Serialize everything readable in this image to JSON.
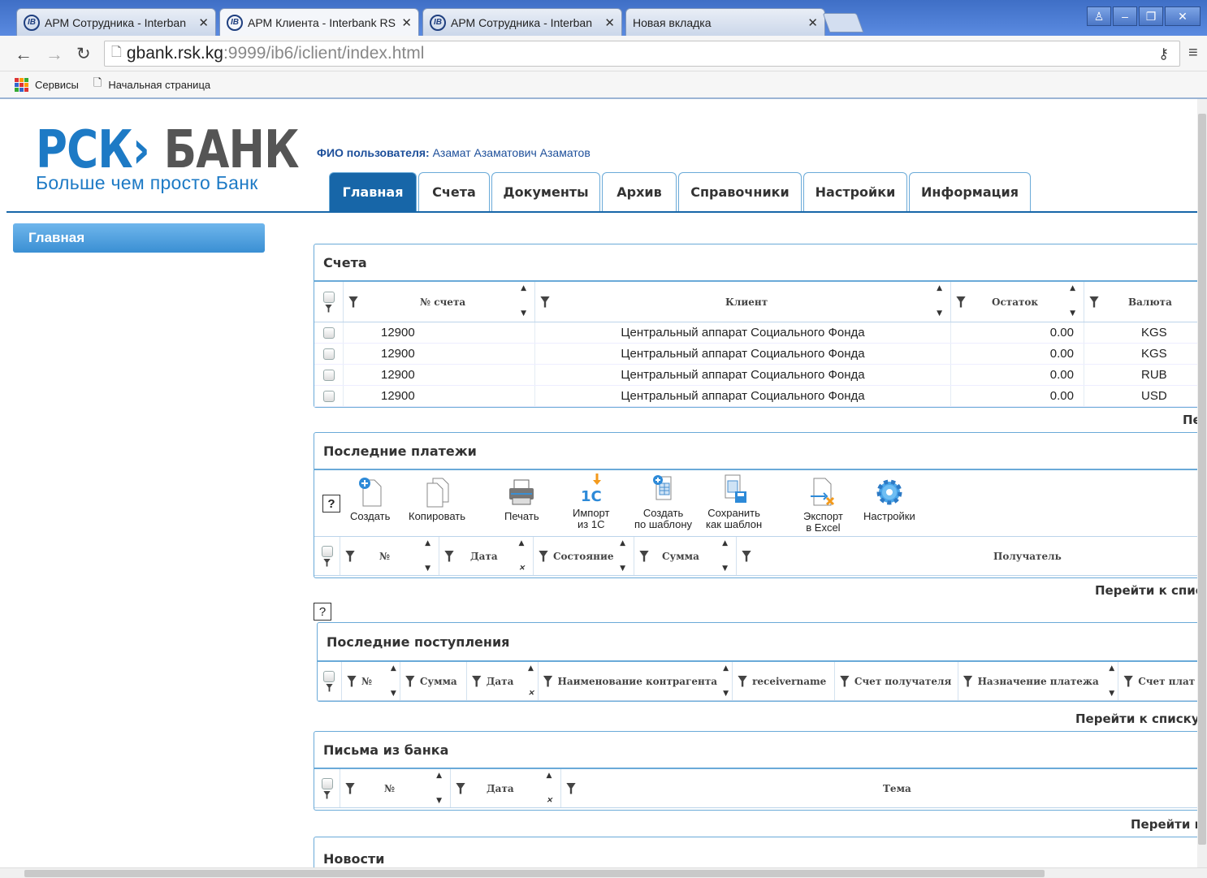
{
  "browser": {
    "tabs": [
      {
        "label": "АРМ Сотрудника - Interban"
      },
      {
        "label": "АРМ Клиента - Interbank RS"
      },
      {
        "label": "АРМ Сотрудника - Interban"
      },
      {
        "label": "Новая вкладка"
      }
    ],
    "url_host": "gbank.rsk.kg",
    "url_rest": ":9999/ib6/iclient/index.html",
    "bookmarks": [
      "Сервисы",
      "Начальная страница"
    ]
  },
  "logo": {
    "rsk": "РСК›",
    "bank": "БАНК",
    "slogan": "Больше чем просто Банк"
  },
  "user": {
    "label": "ФИО пользователя:",
    "name": "Азамат Азаматович Азаматов"
  },
  "main_tabs": [
    "Главная",
    "Счета",
    "Документы",
    "Архив",
    "Справочники",
    "Настройки",
    "Информация"
  ],
  "sidebar": {
    "item": "Главная"
  },
  "accounts": {
    "title": "Счета",
    "columns": [
      "№ счета",
      "Клиент",
      "Остаток",
      "Валюта"
    ],
    "rows": [
      {
        "num": "12900",
        "client": "Центральный аппарат Социального Фонда",
        "balance": "0.00",
        "currency": "KGS"
      },
      {
        "num": "12900",
        "client": "Центральный аппарат Социального Фонда",
        "balance": "0.00",
        "currency": "KGS"
      },
      {
        "num": "12900",
        "client": "Центральный аппарат Социального Фонда",
        "balance": "0.00",
        "currency": "RUB"
      },
      {
        "num": "12900",
        "client": "Центральный аппарат Социального Фонда",
        "balance": "0.00",
        "currency": "USD"
      }
    ],
    "link": "Пе"
  },
  "payments": {
    "title": "Последние платежи",
    "toolbar": {
      "create": "Создать",
      "copy": "Копировать",
      "print": "Печать",
      "import1": "Импорт",
      "import2": "из 1С",
      "tmpl1": "Создать",
      "tmpl2": "по шаблону",
      "save1": "Сохранить",
      "save2": "как шаблон",
      "export1": "Экспорт",
      "export2": "в Excel",
      "settings": "Настройки"
    },
    "columns": [
      "№",
      "Дата",
      "Состояние",
      "Сумма",
      "Получатель"
    ],
    "link": "Перейти к списку"
  },
  "help_mark": "?",
  "incoming": {
    "title": "Последние поступления",
    "columns": [
      "№",
      "Сумма",
      "Дата",
      "Наименование контрагента",
      "receivername",
      "Счет получателя",
      "Назначение платежа",
      "Счет плат"
    ],
    "link": "Перейти к списку пс"
  },
  "letters": {
    "title": "Письма из банка",
    "columns": [
      "№",
      "Дата",
      "Тема"
    ],
    "link": "Перейти к"
  },
  "news": {
    "title": "Новости"
  }
}
